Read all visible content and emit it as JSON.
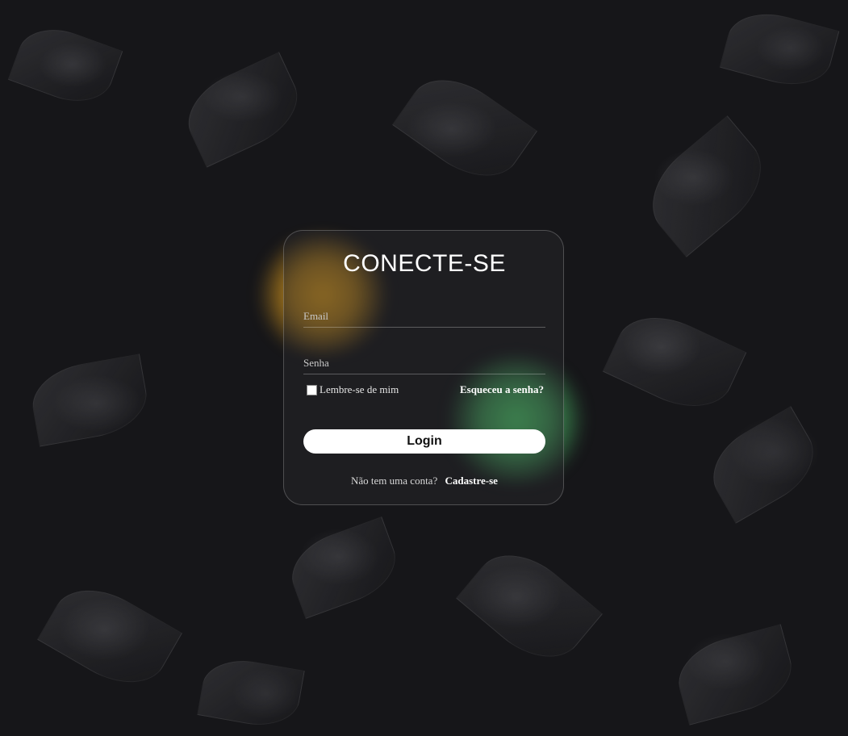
{
  "login": {
    "title": "CONECTE-SE",
    "email_placeholder": "Email",
    "password_placeholder": "Senha",
    "remember_label": "Lembre-se de mim",
    "forgot_label": "Esqueceu a senha?",
    "login_label": "Login",
    "no_account_text": "Não tem uma conta?",
    "signup_label": "Cadastre-se"
  },
  "colors": {
    "accent_yellow": "#E2A01E",
    "accent_green": "#50C86E",
    "background": "#161619",
    "button": "#FFFFFF"
  }
}
